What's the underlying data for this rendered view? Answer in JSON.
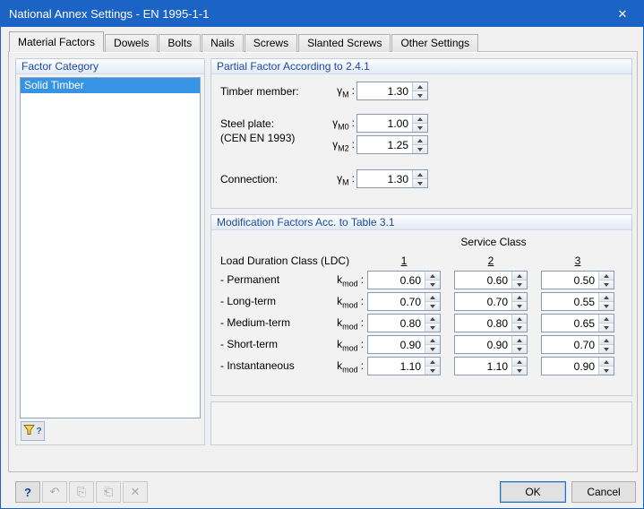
{
  "window": {
    "title": "National Annex Settings - EN 1995-1-1",
    "close_icon": "✕"
  },
  "tabs": {
    "items": [
      {
        "label": "Material Factors"
      },
      {
        "label": "Dowels"
      },
      {
        "label": "Bolts"
      },
      {
        "label": "Nails"
      },
      {
        "label": "Screws"
      },
      {
        "label": "Slanted Screws"
      },
      {
        "label": "Other Settings"
      }
    ]
  },
  "factor_category": {
    "title": "Factor Category",
    "items": [
      {
        "label": "Solid Timber",
        "selected": true
      }
    ]
  },
  "partial_factor": {
    "title": "Partial Factor According to 2.4.1",
    "timber_label": "Timber member:",
    "steel_label": "Steel plate:",
    "steel_note": "(CEN EN 1993)",
    "connection_label": "Connection:",
    "gamma": "γ",
    "sub_m": "M",
    "sub_m0": "M0",
    "sub_m2": "M2",
    "colon": ":",
    "values": {
      "timber": "1.30",
      "steel_m0": "1.00",
      "steel_m2": "1.25",
      "connection": "1.30"
    }
  },
  "modification": {
    "title": "Modification Factors Acc. to Table 3.1",
    "service_class": "Service Class",
    "ldc_label": "Load Duration Class (LDC)",
    "columns": [
      "1",
      "2",
      "3"
    ],
    "k": "k",
    "sub_mod": "mod",
    "colon": ":",
    "rows": [
      {
        "label": "- Permanent",
        "values": [
          "0.60",
          "0.60",
          "0.50"
        ]
      },
      {
        "label": "- Long-term",
        "values": [
          "0.70",
          "0.70",
          "0.55"
        ]
      },
      {
        "label": "- Medium-term",
        "values": [
          "0.80",
          "0.80",
          "0.65"
        ]
      },
      {
        "label": "- Short-term",
        "values": [
          "0.90",
          "0.90",
          "0.70"
        ]
      },
      {
        "label": "- Instantaneous",
        "values": [
          "1.10",
          "1.10",
          "0.90"
        ]
      }
    ]
  },
  "footer": {
    "ok": "OK",
    "cancel": "Cancel",
    "help_icon": "?",
    "undo_icon": "↶",
    "copy_icon": "⎘",
    "paste_icon": "⎗",
    "delete_icon": "✕"
  },
  "colors": {
    "titlebar": "#1b63c5",
    "selection": "#3794e4",
    "group_header_text": "#1d4a9a"
  }
}
